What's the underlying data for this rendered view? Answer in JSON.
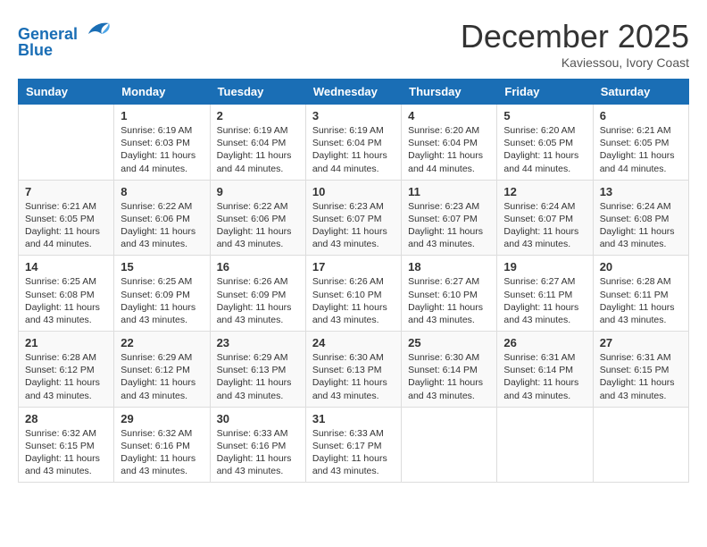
{
  "header": {
    "logo_line1": "General",
    "logo_line2": "Blue",
    "month": "December 2025",
    "location": "Kaviessou, Ivory Coast"
  },
  "days_of_week": [
    "Sunday",
    "Monday",
    "Tuesday",
    "Wednesday",
    "Thursday",
    "Friday",
    "Saturday"
  ],
  "weeks": [
    [
      {
        "day": "",
        "sunrise": "",
        "sunset": "",
        "daylight": ""
      },
      {
        "day": "1",
        "sunrise": "Sunrise: 6:19 AM",
        "sunset": "Sunset: 6:03 PM",
        "daylight": "Daylight: 11 hours and 44 minutes."
      },
      {
        "day": "2",
        "sunrise": "Sunrise: 6:19 AM",
        "sunset": "Sunset: 6:04 PM",
        "daylight": "Daylight: 11 hours and 44 minutes."
      },
      {
        "day": "3",
        "sunrise": "Sunrise: 6:19 AM",
        "sunset": "Sunset: 6:04 PM",
        "daylight": "Daylight: 11 hours and 44 minutes."
      },
      {
        "day": "4",
        "sunrise": "Sunrise: 6:20 AM",
        "sunset": "Sunset: 6:04 PM",
        "daylight": "Daylight: 11 hours and 44 minutes."
      },
      {
        "day": "5",
        "sunrise": "Sunrise: 6:20 AM",
        "sunset": "Sunset: 6:05 PM",
        "daylight": "Daylight: 11 hours and 44 minutes."
      },
      {
        "day": "6",
        "sunrise": "Sunrise: 6:21 AM",
        "sunset": "Sunset: 6:05 PM",
        "daylight": "Daylight: 11 hours and 44 minutes."
      }
    ],
    [
      {
        "day": "7",
        "sunrise": "Sunrise: 6:21 AM",
        "sunset": "Sunset: 6:05 PM",
        "daylight": "Daylight: 11 hours and 44 minutes."
      },
      {
        "day": "8",
        "sunrise": "Sunrise: 6:22 AM",
        "sunset": "Sunset: 6:06 PM",
        "daylight": "Daylight: 11 hours and 43 minutes."
      },
      {
        "day": "9",
        "sunrise": "Sunrise: 6:22 AM",
        "sunset": "Sunset: 6:06 PM",
        "daylight": "Daylight: 11 hours and 43 minutes."
      },
      {
        "day": "10",
        "sunrise": "Sunrise: 6:23 AM",
        "sunset": "Sunset: 6:07 PM",
        "daylight": "Daylight: 11 hours and 43 minutes."
      },
      {
        "day": "11",
        "sunrise": "Sunrise: 6:23 AM",
        "sunset": "Sunset: 6:07 PM",
        "daylight": "Daylight: 11 hours and 43 minutes."
      },
      {
        "day": "12",
        "sunrise": "Sunrise: 6:24 AM",
        "sunset": "Sunset: 6:07 PM",
        "daylight": "Daylight: 11 hours and 43 minutes."
      },
      {
        "day": "13",
        "sunrise": "Sunrise: 6:24 AM",
        "sunset": "Sunset: 6:08 PM",
        "daylight": "Daylight: 11 hours and 43 minutes."
      }
    ],
    [
      {
        "day": "14",
        "sunrise": "Sunrise: 6:25 AM",
        "sunset": "Sunset: 6:08 PM",
        "daylight": "Daylight: 11 hours and 43 minutes."
      },
      {
        "day": "15",
        "sunrise": "Sunrise: 6:25 AM",
        "sunset": "Sunset: 6:09 PM",
        "daylight": "Daylight: 11 hours and 43 minutes."
      },
      {
        "day": "16",
        "sunrise": "Sunrise: 6:26 AM",
        "sunset": "Sunset: 6:09 PM",
        "daylight": "Daylight: 11 hours and 43 minutes."
      },
      {
        "day": "17",
        "sunrise": "Sunrise: 6:26 AM",
        "sunset": "Sunset: 6:10 PM",
        "daylight": "Daylight: 11 hours and 43 minutes."
      },
      {
        "day": "18",
        "sunrise": "Sunrise: 6:27 AM",
        "sunset": "Sunset: 6:10 PM",
        "daylight": "Daylight: 11 hours and 43 minutes."
      },
      {
        "day": "19",
        "sunrise": "Sunrise: 6:27 AM",
        "sunset": "Sunset: 6:11 PM",
        "daylight": "Daylight: 11 hours and 43 minutes."
      },
      {
        "day": "20",
        "sunrise": "Sunrise: 6:28 AM",
        "sunset": "Sunset: 6:11 PM",
        "daylight": "Daylight: 11 hours and 43 minutes."
      }
    ],
    [
      {
        "day": "21",
        "sunrise": "Sunrise: 6:28 AM",
        "sunset": "Sunset: 6:12 PM",
        "daylight": "Daylight: 11 hours and 43 minutes."
      },
      {
        "day": "22",
        "sunrise": "Sunrise: 6:29 AM",
        "sunset": "Sunset: 6:12 PM",
        "daylight": "Daylight: 11 hours and 43 minutes."
      },
      {
        "day": "23",
        "sunrise": "Sunrise: 6:29 AM",
        "sunset": "Sunset: 6:13 PM",
        "daylight": "Daylight: 11 hours and 43 minutes."
      },
      {
        "day": "24",
        "sunrise": "Sunrise: 6:30 AM",
        "sunset": "Sunset: 6:13 PM",
        "daylight": "Daylight: 11 hours and 43 minutes."
      },
      {
        "day": "25",
        "sunrise": "Sunrise: 6:30 AM",
        "sunset": "Sunset: 6:14 PM",
        "daylight": "Daylight: 11 hours and 43 minutes."
      },
      {
        "day": "26",
        "sunrise": "Sunrise: 6:31 AM",
        "sunset": "Sunset: 6:14 PM",
        "daylight": "Daylight: 11 hours and 43 minutes."
      },
      {
        "day": "27",
        "sunrise": "Sunrise: 6:31 AM",
        "sunset": "Sunset: 6:15 PM",
        "daylight": "Daylight: 11 hours and 43 minutes."
      }
    ],
    [
      {
        "day": "28",
        "sunrise": "Sunrise: 6:32 AM",
        "sunset": "Sunset: 6:15 PM",
        "daylight": "Daylight: 11 hours and 43 minutes."
      },
      {
        "day": "29",
        "sunrise": "Sunrise: 6:32 AM",
        "sunset": "Sunset: 6:16 PM",
        "daylight": "Daylight: 11 hours and 43 minutes."
      },
      {
        "day": "30",
        "sunrise": "Sunrise: 6:33 AM",
        "sunset": "Sunset: 6:16 PM",
        "daylight": "Daylight: 11 hours and 43 minutes."
      },
      {
        "day": "31",
        "sunrise": "Sunrise: 6:33 AM",
        "sunset": "Sunset: 6:17 PM",
        "daylight": "Daylight: 11 hours and 43 minutes."
      },
      {
        "day": "",
        "sunrise": "",
        "sunset": "",
        "daylight": ""
      },
      {
        "day": "",
        "sunrise": "",
        "sunset": "",
        "daylight": ""
      },
      {
        "day": "",
        "sunrise": "",
        "sunset": "",
        "daylight": ""
      }
    ]
  ]
}
